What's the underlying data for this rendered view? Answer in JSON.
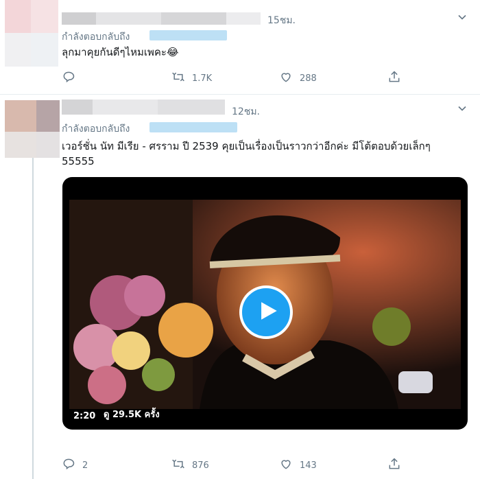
{
  "tweets": [
    {
      "time": "15ชม.",
      "reply_prefix": "กำลังตอบกลับถึง",
      "text": "ลุกมาคุยกันดีๆไหมเพคะ😂",
      "reply_count": "",
      "retweet_count": "1.7K",
      "like_count": "288",
      "icons": [
        "reply-icon",
        "retweet-icon",
        "like-icon",
        "share-icon",
        "chevron-down-icon"
      ]
    },
    {
      "time": "12ชม.",
      "reply_prefix": "กำลังตอบกลับถึง",
      "text_line1": "เวอร์ชั่น นัท มีเรีย - ศรราม ปี 2539 คุยเป็นเรื่องเป็นราวกว่าอีกค่ะ มีโต้ตอบด้วยเล็กๆ",
      "text_line2": "55555",
      "video": {
        "duration": "2:20",
        "views_label": "ดู 29.5K ครั้ง",
        "play_icon": "play-icon"
      },
      "reply_count": "2",
      "retweet_count": "876",
      "like_count": "143",
      "icons": [
        "reply-icon",
        "retweet-icon",
        "like-icon",
        "share-icon",
        "chevron-down-icon"
      ]
    }
  ],
  "colors": {
    "accent": "#1da1f2",
    "secondary_text": "#657786",
    "divider": "#e6ecf0"
  }
}
